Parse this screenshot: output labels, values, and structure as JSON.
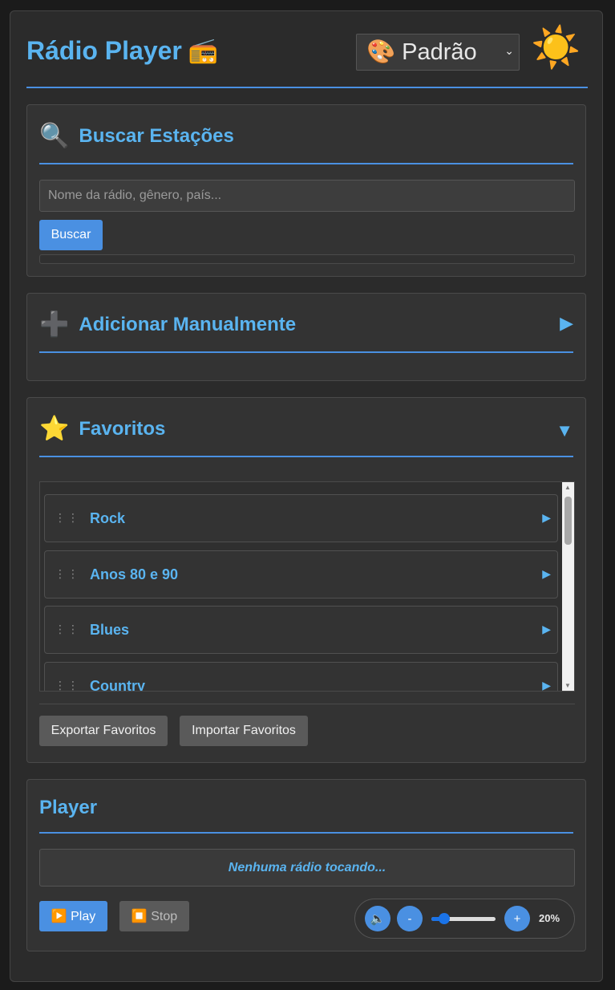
{
  "header": {
    "title": "Rádio Player",
    "title_icon": "📻",
    "theme_select_value": "🎨 Padrão",
    "theme_toggle_icon": "☀️"
  },
  "search": {
    "icon": "🔍",
    "title": "Buscar Estações",
    "placeholder": "Nome da rádio, gênero, país...",
    "button_label": "Buscar"
  },
  "manual": {
    "icon": "➕",
    "title": "Adicionar Manualmente",
    "toggle": "▶"
  },
  "favorites": {
    "icon": "⭐",
    "title": "Favoritos",
    "toggle": "▼",
    "items": [
      {
        "label": "Rock"
      },
      {
        "label": "Anos 80 e 90"
      },
      {
        "label": "Blues"
      },
      {
        "label": "Country"
      }
    ],
    "export_label": "Exportar Favoritos",
    "import_label": "Importar Favoritos"
  },
  "player": {
    "title": "Player",
    "now_playing": "Nenhuma rádio tocando...",
    "play_label": "▶️ Play",
    "stop_label": "⏹️ Stop",
    "volume_icon": "🔈",
    "vol_down": "-",
    "vol_up": "+",
    "volume_percent": 20,
    "volume_text": "20%"
  },
  "colors": {
    "accent": "#4a90e2",
    "title_blue": "#5ab4f0",
    "background": "#2b2b2b"
  }
}
